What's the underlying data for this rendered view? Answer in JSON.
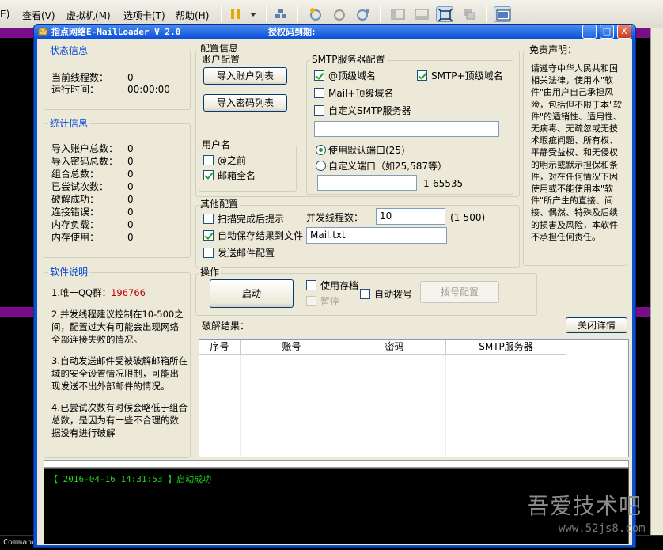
{
  "vm_menu": {
    "items": [
      "E)",
      "查看(V)",
      "虚拟机(M)",
      "选项卡(T)",
      "帮助(H)"
    ]
  },
  "cmd_text": "Command",
  "window": {
    "title": "指点网络E-MailLoader  V 2.0",
    "license": "授权码到期:",
    "minimize": "_",
    "maximize": "□",
    "close": "X"
  },
  "status": {
    "group": "状态信息",
    "threads_label": "当前线程数：",
    "threads_value": "0",
    "runtime_label": "运行时间：",
    "runtime_value": "00:00:00"
  },
  "stats": {
    "group": "统计信息",
    "rows": [
      {
        "label": "导入账户总数：",
        "value": "0"
      },
      {
        "label": "导入密码总数：",
        "value": "0"
      },
      {
        "label": "组合总数：",
        "value": "0"
      },
      {
        "label": "已尝试次数：",
        "value": "0"
      },
      {
        "label": "破解成功：",
        "value": "0"
      },
      {
        "label": "连接错误：",
        "value": "0"
      },
      {
        "label": "内存负载：",
        "value": "0"
      },
      {
        "label": "内存使用：",
        "value": "0"
      }
    ]
  },
  "about": {
    "group": "软件说明",
    "p1a": "1.唯一QQ群：",
    "p1b": "196766",
    "p2": "2.并发线程建议控制在10-500之间，配置过大有可能会出现网络全部连接失败的情况。",
    "p3": "3.自动发送邮件受被破解邮箱所在域的安全设置情况限制，可能出现发送不出外部邮件的情况。",
    "p4": "4.已尝试次数有时候会略低于组合总数，是因为有一些不合理的数据没有进行破解"
  },
  "config": {
    "group": "配置信息",
    "account_group": "账户配置",
    "import_accounts": "导入账户列表",
    "import_passwords": "导入密码列表",
    "username_group": "用户名",
    "opt_before_at": "@之前",
    "opt_full_email": "邮箱全名",
    "smtp_group": "SMTP服务器配置",
    "smtp_opt1": "@顶级域名",
    "smtp_opt2": "SMTP+顶级域名",
    "smtp_opt3": "Mail+顶级域名",
    "smtp_opt4": "自定义SMTP服务器",
    "smtp_custom_value": "",
    "port_default": "使用默认端口(25)",
    "port_custom": "自定义端口（如25,587等）",
    "port_value": "",
    "port_range": "1-65535"
  },
  "other": {
    "group": "其他配置",
    "scan_prompt": "扫描完成后提示",
    "threads_label": "并发线程数：",
    "threads_value": "10",
    "threads_range": "(1-500)",
    "autosave": "自动保存结果到文件",
    "save_file": "Mail.txt",
    "send_mail": "发送邮件配置"
  },
  "ops": {
    "group": "操作",
    "start": "启动",
    "use_archive": "使用存档",
    "pause": "暂停",
    "auto_dial": "自动拨号",
    "dial_config": "拨号配置"
  },
  "disclaimer": {
    "group": "免责声明：",
    "text": "请遵守中华人民共和国相关法律，使用本\"软件\"由用户自己承担风险，包括但不限于本\"软件\"的适销性、适用性、无病毒、无疏忽或无技术瑕疵问题、所有权、平静受益权、和无侵权的明示或默示担保和条件，对在任何情况下因使用或不能使用本\"软件\"所产生的直接、间接、偶然、特殊及后续的损害及风险，本软件不承担任何责任。"
  },
  "results": {
    "label": "破解结果：",
    "close_detail": "关闭详情",
    "columns": [
      "序号",
      "账号",
      "密码",
      "SMTP服务器"
    ]
  },
  "log": {
    "line": "【 2016-04-16 14:31:53 】启动成功"
  },
  "watermark": {
    "line1": "吾爱技术吧",
    "line2": "www.52js8.com"
  },
  "colors": {
    "accent": "#0046d5",
    "titlebar": "#0a50d0",
    "log_text": "#23d323",
    "highlight": "#c00000"
  }
}
